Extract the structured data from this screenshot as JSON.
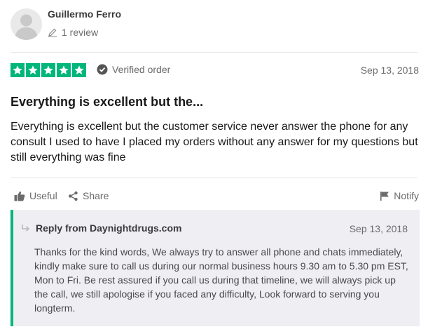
{
  "reviewer": {
    "name": "Guillermo Ferro",
    "review_count": "1 review",
    "avatar_icon": "person-silhouette-icon",
    "edit_icon": "pencil-icon"
  },
  "review": {
    "rating": 5,
    "max_rating": 5,
    "star_color": "#00b67a",
    "verified_label": "Verified order",
    "date": "Sep 13, 2018",
    "title": "Everything is excellent but the...",
    "body": "Everything is excellent but the customer service never answer the phone for any consult I used to have I placed my orders without any answer for my questions but still everything was fine"
  },
  "actions": {
    "useful_label": "Useful",
    "share_label": "Share",
    "notify_label": "Notify"
  },
  "reply": {
    "title": "Reply from Daynightdrugs.com",
    "date": "Sep 13, 2018",
    "body": "Thanks for the kind words, We always try to answer all phone and chats immediately, kindly make sure to call us during our normal business hours 9.30 am to 5.30 pm EST, Mon to Fri. Be rest assured if you call us during that timeline, we will always pick up the call, we still apologise if you faced any difficulty, Look forward to serving you longterm.",
    "accent_color": "#00b67a"
  }
}
